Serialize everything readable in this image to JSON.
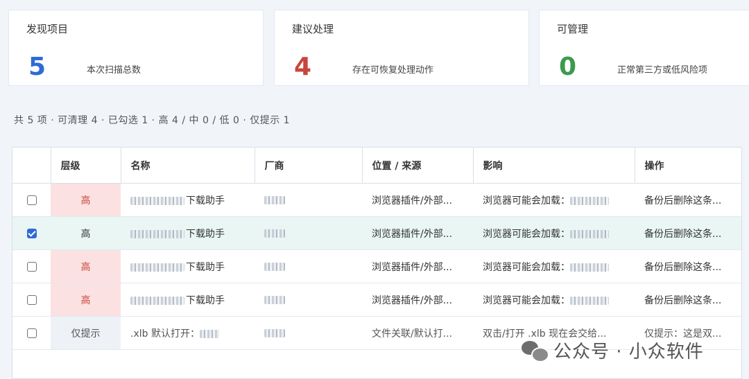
{
  "cards": [
    {
      "title": "发现项目",
      "value": "5",
      "desc": "本次扫描总数",
      "color": "#2f6bd6"
    },
    {
      "title": "建议处理",
      "value": "4",
      "desc": "存在可恢复处理动作",
      "color": "#c7463c"
    },
    {
      "title": "可管理",
      "value": "0",
      "desc": "正常第三方或低风险项",
      "color": "#3c9a4e"
    }
  ],
  "summary": "共 5 项 · 可清理 4 · 已勾选 1 · 高 4 / 中 0 / 低 0 · 仅提示 1",
  "table": {
    "headers": [
      "层级",
      "名称",
      "厂商",
      "位置 / 来源",
      "影响",
      "操作"
    ],
    "rows": [
      {
        "checked": false,
        "level": "高",
        "name": "下载助手",
        "vendor": "",
        "location": "浏览器插件/外部...",
        "impact": "浏览器可能会加载：",
        "action": "备份后删除这条..."
      },
      {
        "checked": true,
        "level": "高",
        "name": "下载助手",
        "vendor": "",
        "location": "浏览器插件/外部...",
        "impact": "浏览器可能会加载：",
        "action": "备份后删除这条..."
      },
      {
        "checked": false,
        "level": "高",
        "name": "下载助手",
        "vendor": "",
        "location": "浏览器插件/外部...",
        "impact": "浏览器可能会加载：",
        "action": "备份后删除这条..."
      },
      {
        "checked": false,
        "level": "高",
        "name": "下载助手",
        "vendor": "",
        "location": "浏览器插件/外部...",
        "impact": "浏览器可能会加载：",
        "action": "备份后删除这条..."
      },
      {
        "checked": false,
        "level": "仅提示",
        "name": ".xlb 默认打开：",
        "vendor": "",
        "location": "文件关联/默认打...",
        "impact": "双击/打开 .xlb 现在会交给...",
        "action": "仅提示：这是双..."
      }
    ]
  },
  "watermark": "公众号 · 小众软件"
}
